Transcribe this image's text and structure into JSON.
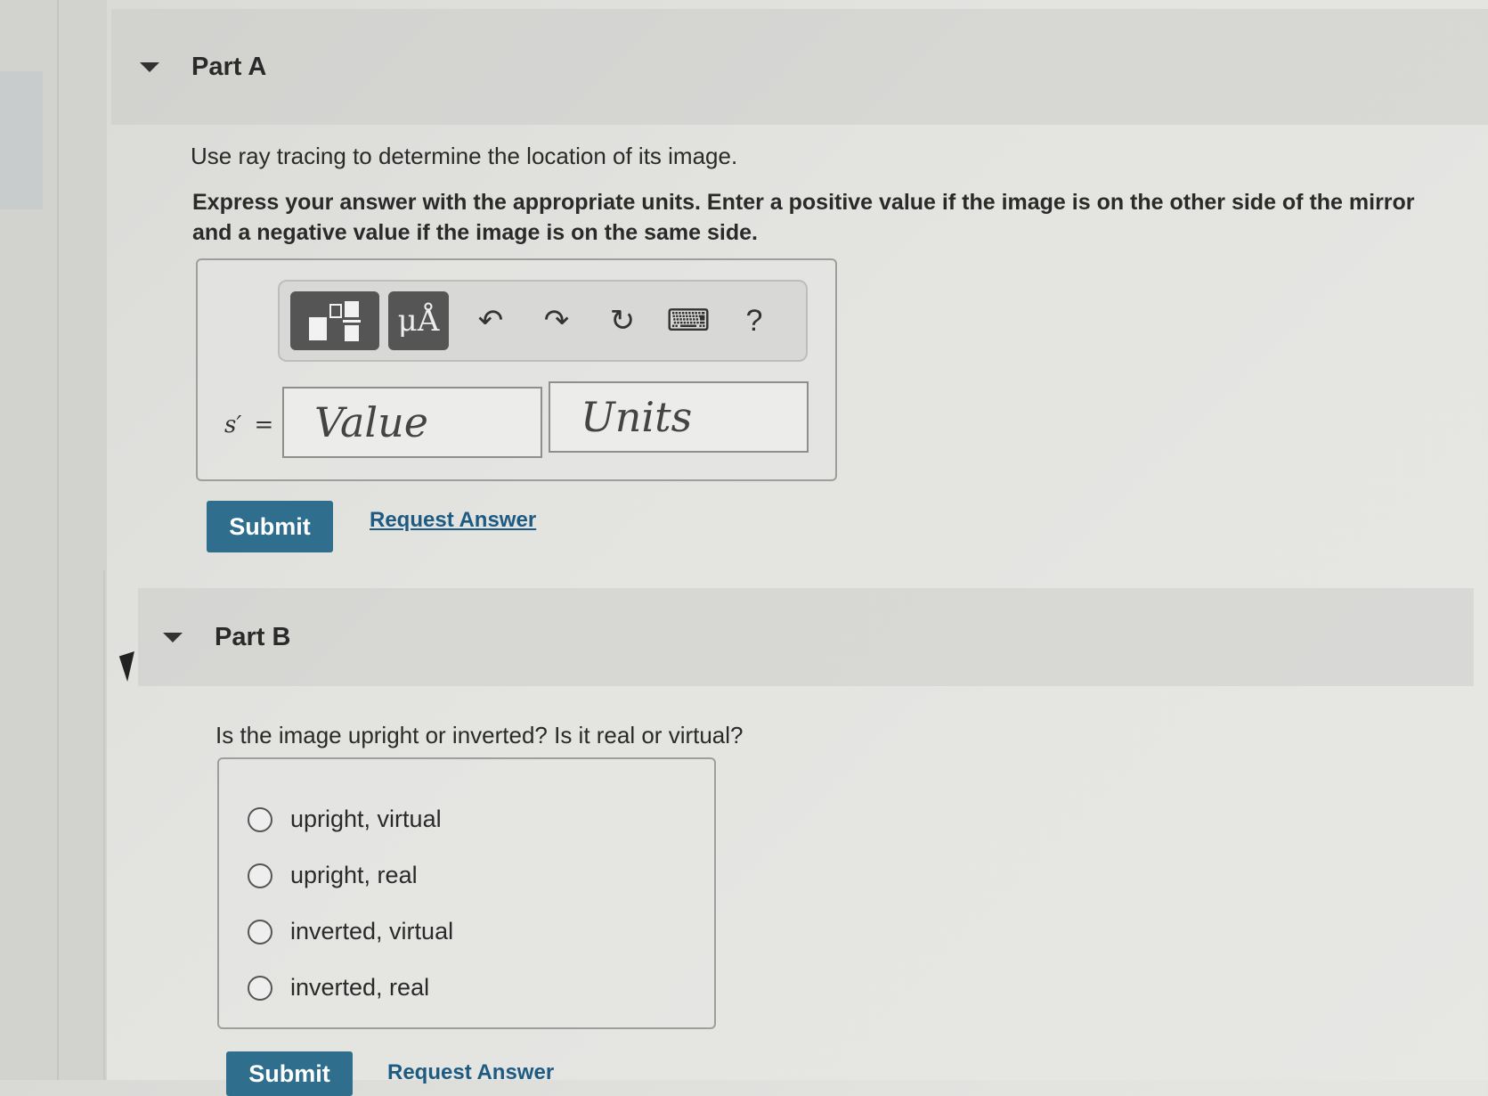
{
  "partA": {
    "title": "Part A",
    "prompt": "Use ray tracing to determine the location of its image.",
    "instruction": "Express your answer with the appropriate units. Enter a positive value if the image is on the other side of the mirror and a negative value if the image is on the same side.",
    "toolbar": {
      "units_glyph": "μÅ",
      "undo_glyph": "↶",
      "redo_glyph": "↷",
      "reset_glyph": "↻",
      "keyboard_glyph": "⌨",
      "help_glyph": "?"
    },
    "variable_label": "s′",
    "equals": "=",
    "value_placeholder": "Value",
    "units_placeholder": "Units",
    "submit_label": "Submit",
    "request_label": "Request Answer"
  },
  "partB": {
    "title": "Part B",
    "prompt": "Is the image upright or inverted? Is it real or virtual?",
    "options": [
      "upright, virtual",
      "upright, real",
      "inverted, virtual",
      "inverted, real"
    ],
    "submit_label": "Submit",
    "request_label": "Request Answer"
  }
}
